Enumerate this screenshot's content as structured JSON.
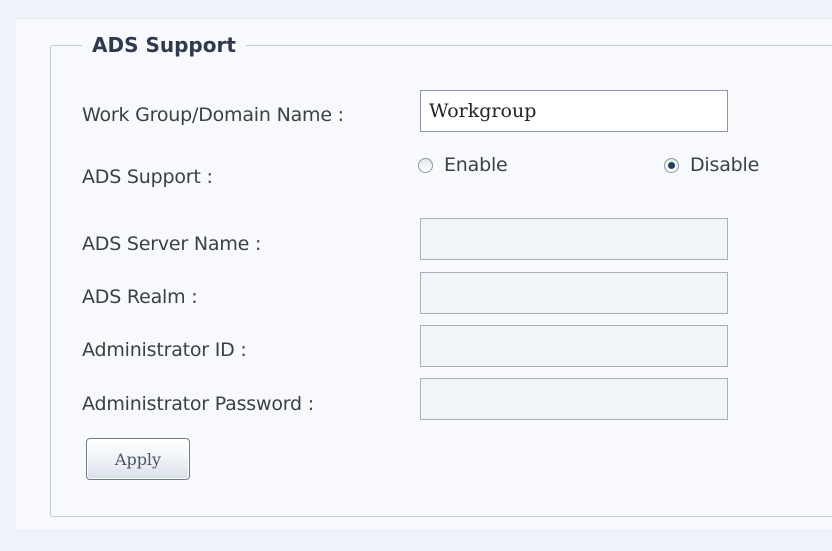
{
  "section": {
    "legend": "ADS Support"
  },
  "fields": {
    "workgroup_label": "Work Group/Domain Name :",
    "workgroup_value": "Workgroup",
    "ads_support_label": "ADS Support :",
    "server_name_label": "ADS Server Name :",
    "server_name_value": "",
    "realm_label": "ADS Realm :",
    "realm_value": "",
    "admin_id_label": "Administrator ID :",
    "admin_id_value": "",
    "admin_password_label": "Administrator Password :",
    "admin_password_value": ""
  },
  "ads_support": {
    "options": [
      {
        "label": "Enable",
        "selected": false
      },
      {
        "label": "Disable",
        "selected": true
      }
    ]
  },
  "actions": {
    "apply_label": "Apply"
  }
}
